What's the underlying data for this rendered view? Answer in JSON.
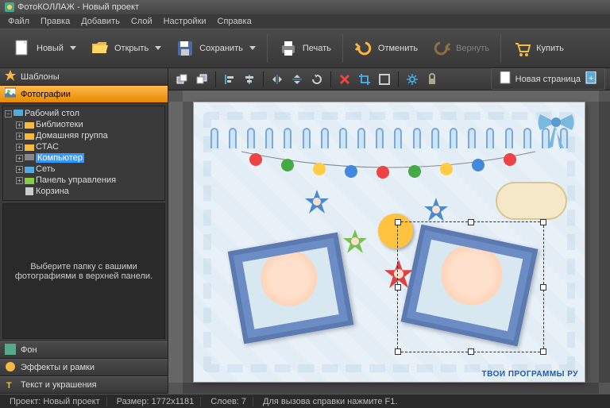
{
  "title": "ФотоКОЛЛАЖ - Новый проект",
  "menu": [
    "Файл",
    "Правка",
    "Добавить",
    "Слой",
    "Настройки",
    "Справка"
  ],
  "toolbar": {
    "new": "Новый",
    "open": "Открыть",
    "save": "Сохранить",
    "print": "Печать",
    "undo": "Отменить",
    "redo": "Вернуть",
    "buy": "Купить"
  },
  "sidebar": {
    "tabs": {
      "templates": "Шаблоны",
      "photos": "Фотографии",
      "background": "Фон",
      "effects": "Эффекты и рамки",
      "text": "Текст и украшения"
    },
    "tree": {
      "root": "Рабочий стол",
      "items": [
        "Библиотеки",
        "Домашняя группа",
        "СТАС",
        "Компьютер",
        "Сеть",
        "Панель управления",
        "Корзина"
      ],
      "selected": "Компьютер"
    },
    "hint": "Выберите папку с вашими фотографиями в верхней панели."
  },
  "canvas_toolbar": {
    "newpage": "Новая страница"
  },
  "status": {
    "project_label": "Проект:",
    "project": "Новый проект",
    "size_label": "Размер:",
    "size": "1772x1181",
    "layers_label": "Слоев:",
    "layers": "7",
    "help": "Для вызова справки нажмите F1."
  },
  "watermark": "ТВОИ ПРОГРАММЫ РУ",
  "colors": {
    "accent": "#e68a00",
    "select": "#3399ff"
  }
}
